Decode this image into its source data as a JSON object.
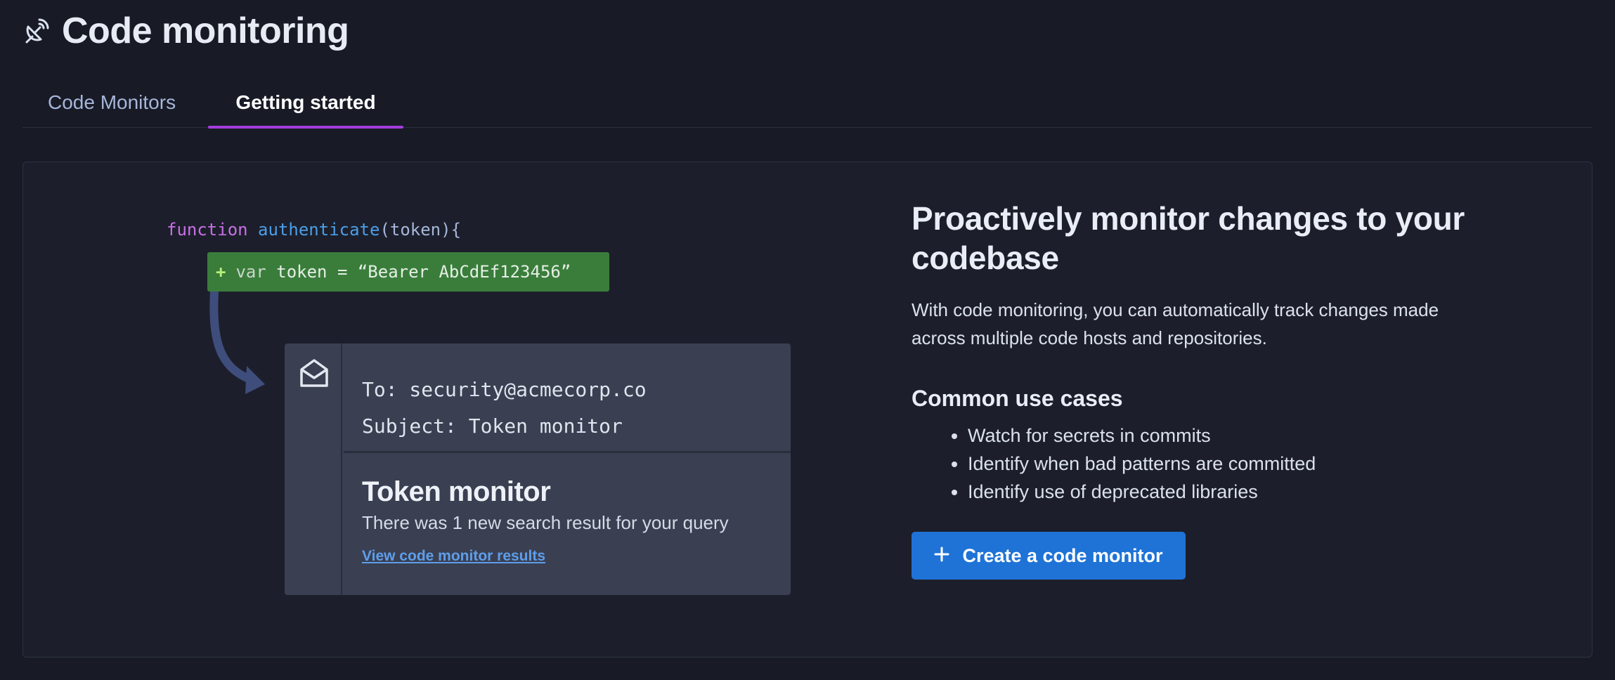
{
  "header": {
    "title": "Code monitoring",
    "icon": "satellite-dish-icon"
  },
  "tabs": [
    {
      "label": "Code Monitors",
      "active": false
    },
    {
      "label": "Getting started",
      "active": true
    }
  ],
  "illustration": {
    "code": {
      "keyword": "function",
      "name": "authenticate",
      "rest": "(token){"
    },
    "added": {
      "plus": "+",
      "keyword": "var",
      "rest": " token = “Bearer AbCdEf123456”"
    },
    "email": {
      "to": "To: security@acmecorp.co",
      "subject": "Subject: Token monitor",
      "title": "Token monitor",
      "text": "There was 1 new search result for your query",
      "link": "View code monitor results"
    }
  },
  "content": {
    "heading": "Proactively monitor changes to your codebase",
    "description": "With code monitoring, you can automatically track changes made across multiple code hosts and repositories.",
    "use_cases_title": "Common use cases",
    "use_cases": [
      "Watch for secrets in commits",
      "Identify when bad patterns are committed",
      "Identify use of deprecated libraries"
    ],
    "cta": "Create a code monitor"
  },
  "colors": {
    "background": "#181b26",
    "accent_tab": "#a33ddb",
    "primary_button": "#1f73d6",
    "added_line": "#3a7d3b"
  }
}
